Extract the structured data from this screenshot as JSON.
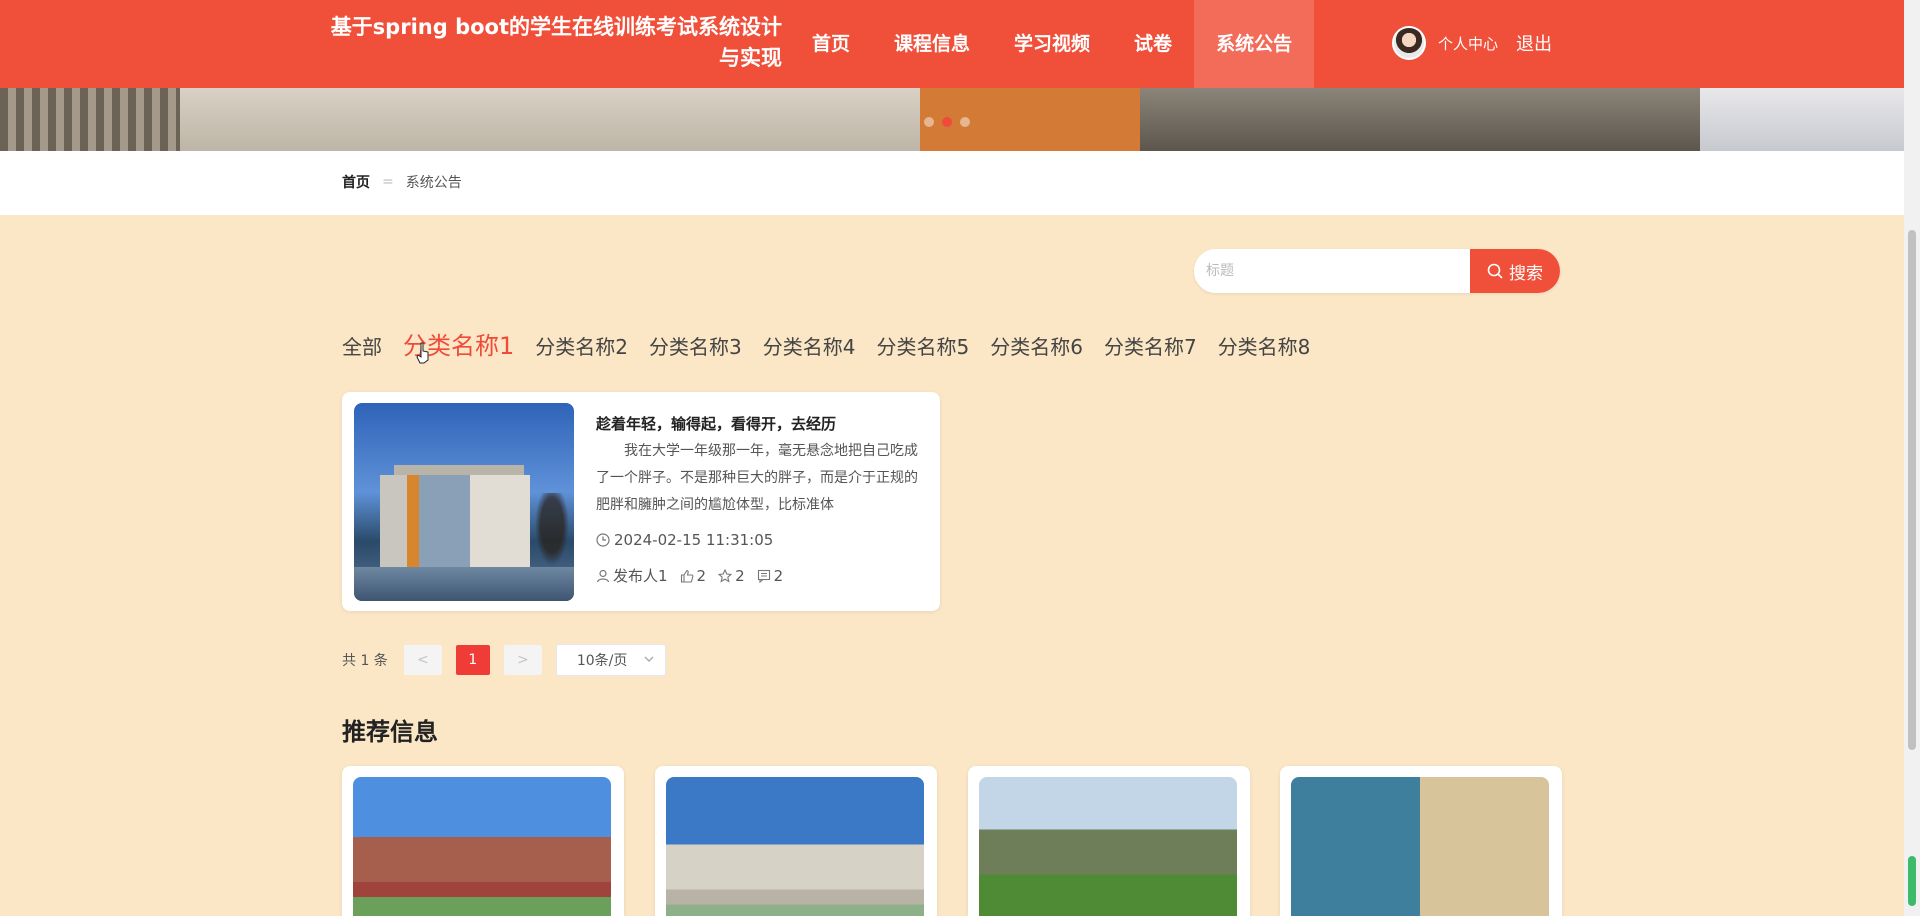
{
  "header": {
    "site_title": "基于spring boot的学生在线训练考试系统设计与实现",
    "nav": [
      "首页",
      "课程信息",
      "学习视频",
      "试卷",
      "系统公告"
    ],
    "active_nav": "系统公告",
    "user_center": "个人中心",
    "logout": "退出"
  },
  "banner": {
    "active_dot": 1,
    "dot_count": 3
  },
  "breadcrumb": {
    "home": "首页",
    "separator": "=",
    "current": "系统公告"
  },
  "search": {
    "placeholder": "标题",
    "button": "搜索"
  },
  "categories": {
    "items": [
      "全部",
      "分类名称1",
      "分类名称2",
      "分类名称3",
      "分类名称4",
      "分类名称5",
      "分类名称6",
      "分类名称7",
      "分类名称8"
    ],
    "active": "分类名称1"
  },
  "article": {
    "title": "趁着年轻，输得起，看得开，去经历",
    "excerpt": "我在大学一年级那一年，毫无悬念地把自己吃成了一个胖子。不是那种巨大的胖子，而是介于正规的肥胖和臃肿之间的尴尬体型，比标准体",
    "time": "2024-02-15 11:31:05",
    "author": "发布人1",
    "likes": "2",
    "favorites": "2",
    "comments": "2"
  },
  "pagination": {
    "total": "共 1 条",
    "prev": "<",
    "current_page": "1",
    "next": ">",
    "page_size": "10条/页"
  },
  "recommend": {
    "title": "推荐信息"
  },
  "colors": {
    "brand": "#f0503a",
    "active_text": "#f04a3a",
    "page_bg": "#fbe7c6"
  }
}
